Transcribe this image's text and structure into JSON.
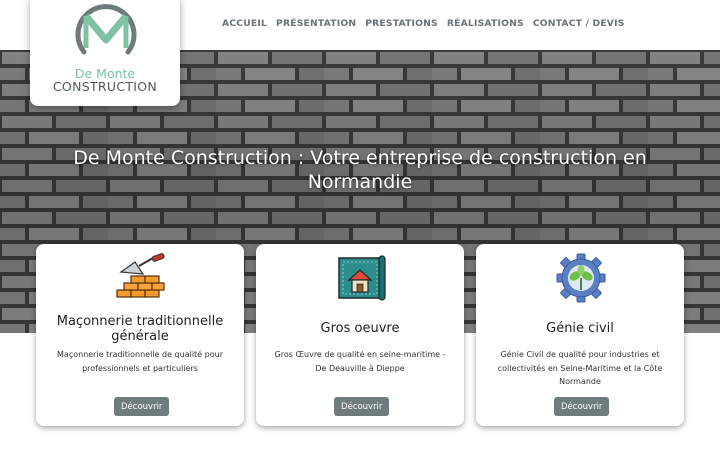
{
  "brand": {
    "name_line1": "De Monte",
    "name_line2": "CONSTRUCTION",
    "logo_color": "#7ec1a3",
    "logo_ring_color": "#6f7a7a"
  },
  "nav": {
    "items": [
      {
        "label": "ACCUEIL"
      },
      {
        "label": "PRÉSENTATION"
      },
      {
        "label": "PRESTATIONS"
      },
      {
        "label": "RÉALISATIONS"
      },
      {
        "label": "CONTACT / DEVIS"
      }
    ]
  },
  "hero": {
    "title": "De Monte Construction : Votre entreprise de construction en Normandie",
    "background": "grey-brick-wall"
  },
  "cards": [
    {
      "icon": "trowel-bricks-icon",
      "title": "Maçonnerie traditionnelle générale",
      "text": "Maçonnerie traditionnelle de qualité pour professionnels et particuliers",
      "button": "Découvrir"
    },
    {
      "icon": "house-blueprint-icon",
      "title": "Gros oeuvre",
      "text": "Gros Œuvre de qualité en seine-maritime - De Deauville à Dieppe",
      "button": "Découvrir"
    },
    {
      "icon": "gear-plant-icon",
      "title": "Génie civil",
      "text": "Génie Civil de qualité pour industries et collectivités en Seine-Maritime et la Côte Normande",
      "button": "Découvrir"
    }
  ],
  "colors": {
    "button_bg": "#6e7c7c",
    "nav_text": "#6a7276"
  }
}
